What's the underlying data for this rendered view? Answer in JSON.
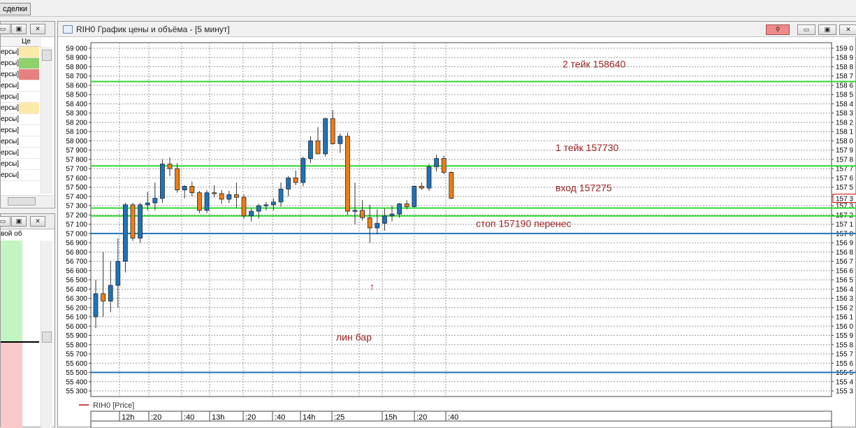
{
  "top_tab": {
    "label": "сделки"
  },
  "left_panel_top": {
    "header_col": "Це",
    "rows": [
      {
        "label": "ерсы]",
        "color": "#fde9a7"
      },
      {
        "label": "ерсы]",
        "color": "#8fd16a"
      },
      {
        "label": "ерсы]",
        "color": "#e88080"
      },
      {
        "label": "ерсы]",
        "color": ""
      },
      {
        "label": "ерсы]",
        "color": ""
      },
      {
        "label": "ерсы]",
        "color": "#fde9a7"
      },
      {
        "label": "ерсы]",
        "color": ""
      },
      {
        "label": "ерсы]",
        "color": ""
      },
      {
        "label": "ерсы]",
        "color": ""
      },
      {
        "label": "ерсы]",
        "color": ""
      },
      {
        "label": "ерсы]",
        "color": ""
      },
      {
        "label": "ерсы]",
        "color": ""
      }
    ]
  },
  "left_panel_bottom": {
    "header": "вой об"
  },
  "window": {
    "title": "RIH0 График цены и объёма - [5 минут]"
  },
  "legend": {
    "text": "RIH0 [Price]",
    "color": "#cc0000"
  },
  "colors": {
    "bull_candle": "#1f73b7",
    "bear_candle": "#f07d12",
    "green_line": "#2dd82d",
    "blue_line": "#1f73b7",
    "annotation": "#9b2222",
    "arrow": "#e01010"
  },
  "annotations": {
    "take2": "2 тейк 158640",
    "take1": "1 тейк 157730",
    "entry": "вход 157275",
    "stop": "стоп 157190 перенес",
    "lin_bar": "лин бар",
    "arrow": "↑"
  },
  "right_axis_marker": "157 3",
  "chart_data": {
    "type": "candlestick",
    "instrument": "RIH0",
    "timeframe": "5 минут",
    "ylim": [
      155300,
      159000
    ],
    "y_ticks": [
      159000,
      158900,
      158800,
      158700,
      158600,
      158500,
      158400,
      158300,
      158200,
      158100,
      158000,
      157900,
      157800,
      157700,
      157600,
      157500,
      157400,
      157300,
      157200,
      157100,
      157000,
      156900,
      156800,
      156700,
      156600,
      156500,
      156400,
      156300,
      156200,
      156100,
      156000,
      155900,
      155800,
      155700,
      155600,
      155500,
      155400,
      155300
    ],
    "y_tick_labels_left": [
      "59 000",
      "58 900",
      "58 800",
      "58 700",
      "58 600",
      "58 500",
      "58 400",
      "58 300",
      "58 200",
      "58 100",
      "58 000",
      "57 900",
      "57 800",
      "57 700",
      "57 600",
      "57 500",
      "57 400",
      "57 300",
      "57 200",
      "57 100",
      "57 000",
      "56 900",
      "56 800",
      "56 700",
      "56 600",
      "56 500",
      "56 400",
      "56 300",
      "56 200",
      "56 100",
      "56 000",
      "55 900",
      "55 800",
      "55 700",
      "55 600",
      "55 500",
      "55 400",
      "55 300"
    ],
    "y_tick_labels_right": [
      "159 0",
      "158 9",
      "158 8",
      "158 7",
      "158 6",
      "158 5",
      "158 4",
      "158 3",
      "158 2",
      "158 1",
      "158 0",
      "157 9",
      "157 8",
      "157 7",
      "157 6",
      "157 5",
      "157 4",
      "157 3",
      "157 2",
      "157 1",
      "157 0",
      "156 9",
      "156 8",
      "156 7",
      "156 6",
      "156 5",
      "156 4",
      "156 3",
      "156 2",
      "156 1",
      "156 0",
      "155 9",
      "155 8",
      "155 7",
      "155 6",
      "155 5",
      "155 4",
      "155 3"
    ],
    "x_labels": [
      "12h",
      ":20",
      ":40",
      "13h",
      ":20",
      ":40",
      "14h",
      ":25",
      "15h",
      ":20",
      ":40"
    ],
    "candles": [
      {
        "o": 156100,
        "h": 156500,
        "l": 155980,
        "c": 156350
      },
      {
        "o": 156350,
        "h": 156800,
        "l": 156100,
        "c": 156270
      },
      {
        "o": 156270,
        "h": 156700,
        "l": 156150,
        "c": 156440
      },
      {
        "o": 156440,
        "h": 156950,
        "l": 156200,
        "c": 156700
      },
      {
        "o": 156700,
        "h": 157330,
        "l": 156580,
        "c": 157310
      },
      {
        "o": 157310,
        "h": 157330,
        "l": 156920,
        "c": 156950
      },
      {
        "o": 156950,
        "h": 157330,
        "l": 156900,
        "c": 157310
      },
      {
        "o": 157310,
        "h": 157450,
        "l": 157250,
        "c": 157330
      },
      {
        "o": 157330,
        "h": 157550,
        "l": 157250,
        "c": 157380
      },
      {
        "o": 157380,
        "h": 157800,
        "l": 157330,
        "c": 157750
      },
      {
        "o": 157750,
        "h": 157820,
        "l": 157620,
        "c": 157700
      },
      {
        "o": 157700,
        "h": 157760,
        "l": 157440,
        "c": 157470
      },
      {
        "o": 157470,
        "h": 157520,
        "l": 157380,
        "c": 157510
      },
      {
        "o": 157510,
        "h": 157560,
        "l": 157400,
        "c": 157440
      },
      {
        "o": 157440,
        "h": 157460,
        "l": 157220,
        "c": 157250
      },
      {
        "o": 157250,
        "h": 157470,
        "l": 157220,
        "c": 157440
      },
      {
        "o": 157440,
        "h": 157520,
        "l": 157390,
        "c": 157430
      },
      {
        "o": 157430,
        "h": 157470,
        "l": 157320,
        "c": 157370
      },
      {
        "o": 157370,
        "h": 157460,
        "l": 157330,
        "c": 157420
      },
      {
        "o": 157420,
        "h": 157550,
        "l": 157280,
        "c": 157390
      },
      {
        "o": 157390,
        "h": 157420,
        "l": 157160,
        "c": 157190
      },
      {
        "o": 157190,
        "h": 157270,
        "l": 157130,
        "c": 157240
      },
      {
        "o": 157240,
        "h": 157320,
        "l": 157160,
        "c": 157300
      },
      {
        "o": 157300,
        "h": 157340,
        "l": 157250,
        "c": 157310
      },
      {
        "o": 157310,
        "h": 157380,
        "l": 157250,
        "c": 157340
      },
      {
        "o": 157340,
        "h": 157550,
        "l": 157290,
        "c": 157480
      },
      {
        "o": 157480,
        "h": 157620,
        "l": 157400,
        "c": 157600
      },
      {
        "o": 157600,
        "h": 157680,
        "l": 157520,
        "c": 157550
      },
      {
        "o": 157550,
        "h": 157830,
        "l": 157510,
        "c": 157810
      },
      {
        "o": 157810,
        "h": 158050,
        "l": 157760,
        "c": 158000
      },
      {
        "o": 158000,
        "h": 158150,
        "l": 157880,
        "c": 157860
      },
      {
        "o": 157860,
        "h": 158250,
        "l": 157830,
        "c": 158240
      },
      {
        "o": 158240,
        "h": 158330,
        "l": 157960,
        "c": 157970
      },
      {
        "o": 157970,
        "h": 158080,
        "l": 157870,
        "c": 158050
      },
      {
        "o": 158050,
        "h": 158090,
        "l": 157200,
        "c": 157240
      },
      {
        "o": 157240,
        "h": 157550,
        "l": 157100,
        "c": 157250
      },
      {
        "o": 157250,
        "h": 157360,
        "l": 157140,
        "c": 157170
      },
      {
        "o": 157170,
        "h": 157310,
        "l": 156900,
        "c": 157060
      },
      {
        "o": 157060,
        "h": 157260,
        "l": 156990,
        "c": 157110
      },
      {
        "o": 157110,
        "h": 157270,
        "l": 157030,
        "c": 157190
      },
      {
        "o": 157190,
        "h": 157300,
        "l": 157130,
        "c": 157210
      },
      {
        "o": 157210,
        "h": 157330,
        "l": 157170,
        "c": 157320
      },
      {
        "o": 157320,
        "h": 157360,
        "l": 157260,
        "c": 157290
      },
      {
        "o": 157290,
        "h": 157520,
        "l": 157280,
        "c": 157510
      },
      {
        "o": 157510,
        "h": 157550,
        "l": 157470,
        "c": 157490
      },
      {
        "o": 157490,
        "h": 157750,
        "l": 157460,
        "c": 157720
      },
      {
        "o": 157720,
        "h": 157850,
        "l": 157670,
        "c": 157810
      },
      {
        "o": 157810,
        "h": 157840,
        "l": 157640,
        "c": 157660
      },
      {
        "o": 157660,
        "h": 157670,
        "l": 157370,
        "c": 157380
      }
    ],
    "hlines": [
      {
        "value": 158640,
        "color": "#2dd82d",
        "label": "2 тейк 158640"
      },
      {
        "value": 157730,
        "color": "#2dd82d",
        "label": "1 тейк 157730"
      },
      {
        "value": 157275,
        "color": "#2dd82d",
        "label": "вход 157275"
      },
      {
        "value": 157190,
        "color": "#2dd82d",
        "label": "стоп 157190 перенес"
      },
      {
        "value": 157000,
        "color": "#1f73b7"
      },
      {
        "value": 155500,
        "color": "#1f73b7"
      }
    ],
    "grid": true
  }
}
